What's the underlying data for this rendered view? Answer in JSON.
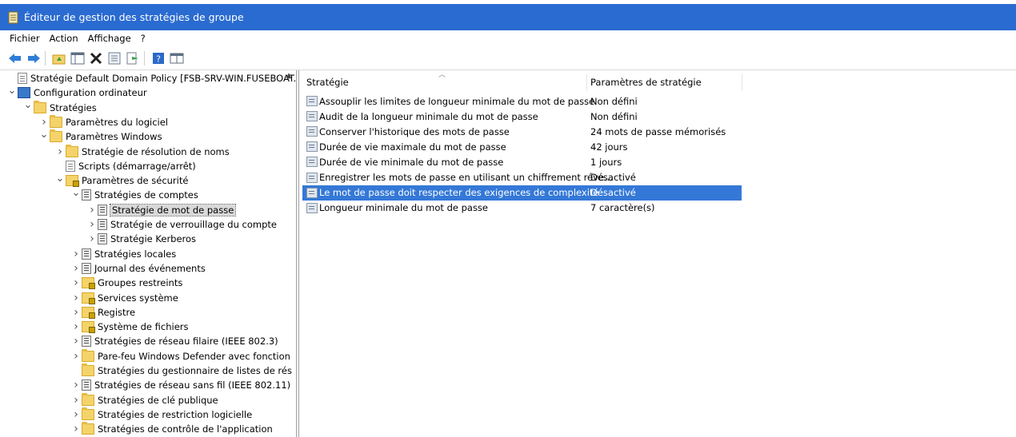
{
  "window": {
    "title": "Éditeur de gestion des stratégies de groupe"
  },
  "menu": [
    "Fichier",
    "Action",
    "Affichage",
    "?"
  ],
  "toolbar": {
    "buttons": [
      "back-icon",
      "forward-icon",
      "up-folder-icon",
      "show-hide-tree-icon",
      "delete-icon",
      "properties-icon",
      "export-list-icon",
      "help-icon",
      "details-view-icon"
    ]
  },
  "tree": {
    "items": [
      {
        "label": "Stratégie Default Domain Policy [FSB-SRV-WIN.FUSEBOAT.CC",
        "icon": "policy-doc-icon",
        "arrow": ""
      },
      {
        "label": "Configuration ordinateur",
        "icon": "computer-icon",
        "arrow": "down"
      },
      {
        "label": "Stratégies",
        "icon": "folder-icon",
        "arrow": "down"
      },
      {
        "label": "Paramètres du logiciel",
        "icon": "folder-icon",
        "arrow": "right"
      },
      {
        "label": "Paramètres Windows",
        "icon": "folder-icon",
        "arrow": "down"
      },
      {
        "label": "Stratégie de résolution de noms",
        "icon": "folder-icon",
        "arrow": "right"
      },
      {
        "label": "Scripts (démarrage/arrêt)",
        "icon": "script-icon",
        "arrow": ""
      },
      {
        "label": "Paramètres de sécurité",
        "icon": "security-icon",
        "arrow": "down"
      },
      {
        "label": "Stratégies de comptes",
        "icon": "list-icon",
        "arrow": "down"
      },
      {
        "label": "Stratégie de mot de passe",
        "icon": "list-icon",
        "arrow": "right"
      },
      {
        "label": "Stratégie de verrouillage du compte",
        "icon": "list-icon",
        "arrow": "right"
      },
      {
        "label": "Stratégie Kerberos",
        "icon": "list-icon",
        "arrow": "right"
      },
      {
        "label": "Stratégies locales",
        "icon": "list-icon",
        "arrow": "right"
      },
      {
        "label": "Journal des événements",
        "icon": "list-icon",
        "arrow": "right"
      },
      {
        "label": "Groupes restreints",
        "icon": "lock-folder-icon",
        "arrow": "right"
      },
      {
        "label": "Services système",
        "icon": "lock-folder-icon",
        "arrow": "right"
      },
      {
        "label": "Registre",
        "icon": "lock-folder-icon",
        "arrow": "right"
      },
      {
        "label": "Système de fichiers",
        "icon": "lock-folder-icon",
        "arrow": "right"
      },
      {
        "label": "Stratégies de réseau filaire (IEEE 802.3)",
        "icon": "network-icon",
        "arrow": "right"
      },
      {
        "label": "Pare-feu Windows Defender avec fonction",
        "icon": "folder-icon",
        "arrow": "right"
      },
      {
        "label": "Stratégies du gestionnaire de listes de rés",
        "icon": "folder-icon",
        "arrow": ""
      },
      {
        "label": "Stratégies de réseau sans fil (IEEE 802.11)",
        "icon": "wireless-icon",
        "arrow": "right"
      },
      {
        "label": "Stratégies de clé publique",
        "icon": "folder-icon",
        "arrow": "right"
      },
      {
        "label": "Stratégies de restriction logicielle",
        "icon": "folder-icon",
        "arrow": "right"
      },
      {
        "label": "Stratégies de contrôle de l'application",
        "icon": "folder-icon",
        "arrow": "right"
      }
    ],
    "selected_index": 9
  },
  "list": {
    "columns": [
      "Stratégie",
      "Paramètres de stratégie"
    ],
    "rows": [
      {
        "name": "Assouplir les limites de longueur minimale du mot de passe",
        "value": "Non défini"
      },
      {
        "name": "Audit de la longueur minimale du mot de passe",
        "value": "Non défini"
      },
      {
        "name": "Conserver l'historique des mots de passe",
        "value": "24 mots de passe mémorisés"
      },
      {
        "name": "Durée de vie maximale du mot de passe",
        "value": "42 jours"
      },
      {
        "name": "Durée de vie minimale du mot de passe",
        "value": "1 jours"
      },
      {
        "name": "Enregistrer les mots de passe en utilisant un chiffrement réve...",
        "value": "Désactivé"
      },
      {
        "name": "Le mot de passe doit respecter des exigences de complexité",
        "value": "Désactivé"
      },
      {
        "name": "Longueur minimale du mot de passe",
        "value": "7 caractère(s)"
      }
    ],
    "selected_index": 6
  },
  "colors": {
    "titlebar": "#2a6bd1",
    "selection": "#3478d7"
  }
}
